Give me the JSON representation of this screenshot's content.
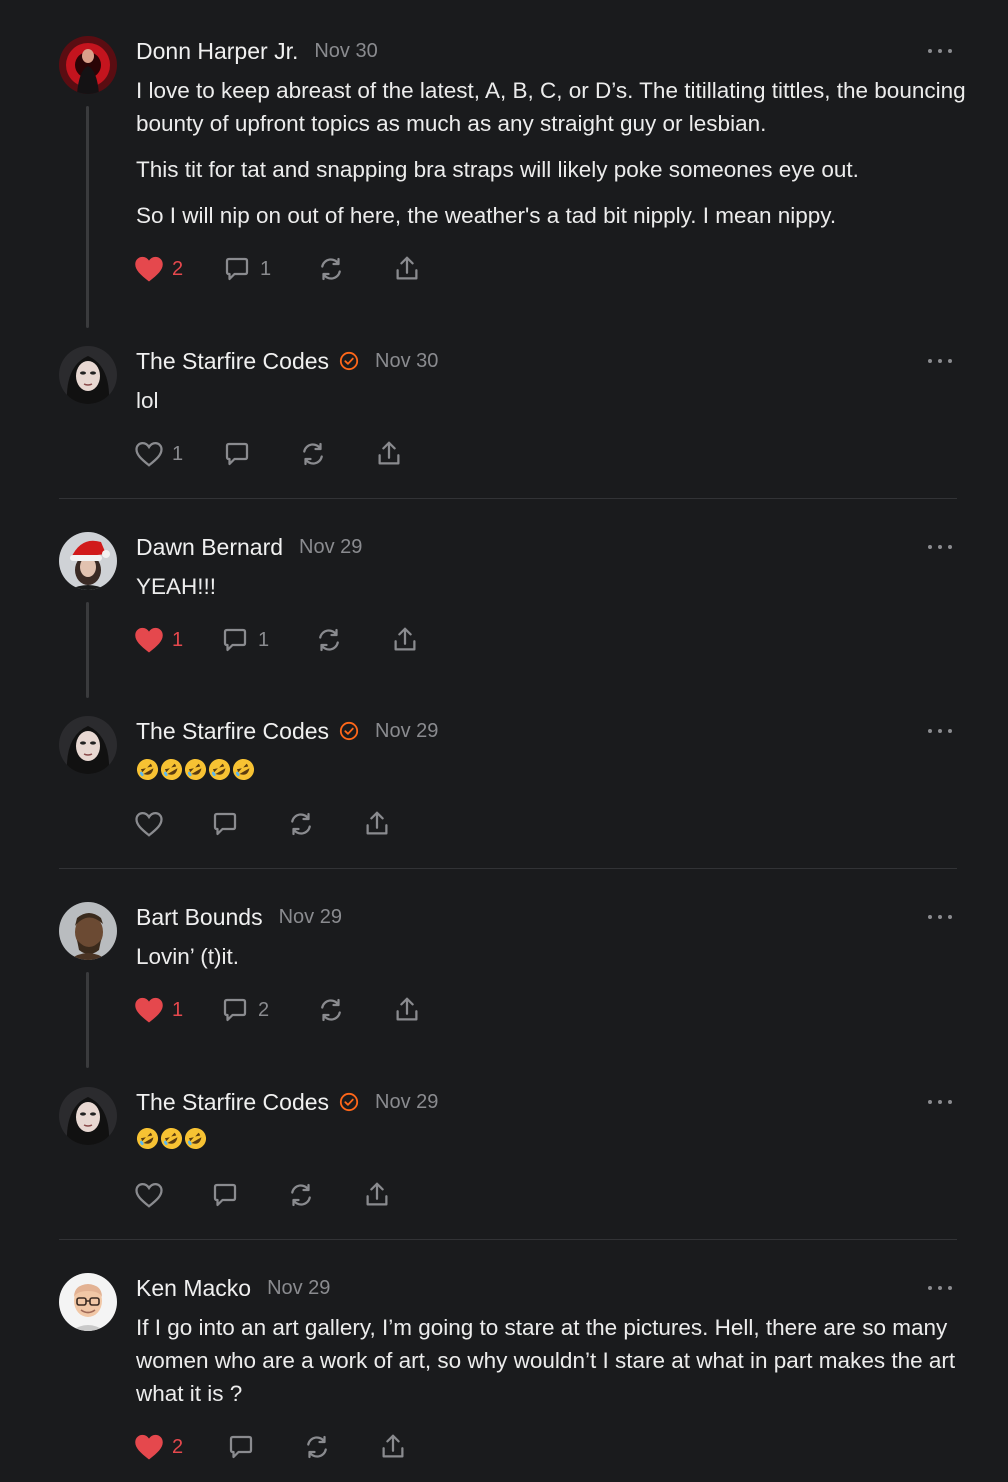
{
  "comments": [
    {
      "author": "Donn Harper Jr.",
      "date": "Nov 30",
      "verified": false,
      "paragraphs": [
        "I love to keep abreast of the latest, A, B, C, or D’s. The titillating tittles, the bouncing bounty of upfront topics as much as any straight guy or lesbian.",
        "This tit for tat and snapping bra straps will likely poke someones eye out.",
        "So I will nip on out of here, the weather's a tad bit nipply. I mean nippy."
      ],
      "likes": "2",
      "liked": true,
      "replies": "1"
    },
    {
      "author": "The Starfire Codes",
      "date": "Nov 30",
      "verified": true,
      "text": "lol",
      "likes": "1",
      "liked": false,
      "replies": ""
    },
    {
      "author": "Dawn Bernard",
      "date": "Nov 29",
      "verified": false,
      "text": "YEAH!!!",
      "likes": "1",
      "liked": true,
      "replies": "1"
    },
    {
      "author": "The Starfire Codes",
      "date": "Nov 29",
      "verified": true,
      "emoji_count": 5,
      "emoji": "rolling-on-floor-laughing",
      "likes": "",
      "liked": false,
      "replies": ""
    },
    {
      "author": "Bart Bounds",
      "date": "Nov 29",
      "verified": false,
      "text": "Lovin’ (t)it.",
      "likes": "1",
      "liked": true,
      "replies": "2"
    },
    {
      "author": "The Starfire Codes",
      "date": "Nov 29",
      "verified": true,
      "emoji_count": 3,
      "emoji": "rolling-on-floor-laughing",
      "likes": "",
      "liked": false,
      "replies": ""
    },
    {
      "author": "Ken Macko",
      "date": "Nov 29",
      "verified": false,
      "text": "If I go into an art gallery, I’m going to stare at the pictures. Hell, there are so many women who are a work of art, so why wouldn’t I stare at what in part makes the art what it is ?",
      "likes": "2",
      "liked": true,
      "replies": ""
    }
  ],
  "colors": {
    "accent": "#e5484d",
    "verified": "#ff6719",
    "muted": "#8a8b8f",
    "background": "#1a1b1d"
  }
}
